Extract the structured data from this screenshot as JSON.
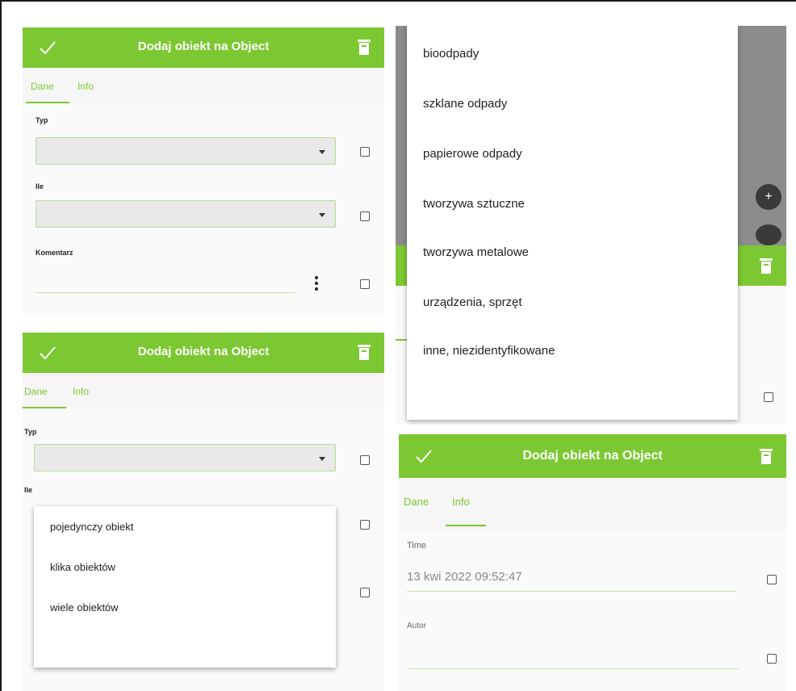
{
  "colors": {
    "accent": "#7cc832",
    "panel_bg": "#fafafa"
  },
  "panel_top_left": {
    "appbar": {
      "title": "Dodaj obiekt na Object",
      "confirm_icon": "check-icon",
      "delete_icon": "trash-icon"
    },
    "tabs": [
      "Dane",
      "Info"
    ],
    "active_tab": "Dane",
    "fields": {
      "typ_label": "Typ",
      "ile_label": "Ile",
      "komentarz_label": "Komentarz"
    }
  },
  "panel_bottom_left": {
    "appbar": {
      "title": "Dodaj obiekt na Object"
    },
    "tabs": [
      "Dane",
      "Info"
    ],
    "active_tab": "Dane",
    "fields": {
      "typ_label": "Typ",
      "ile_label": "Ile"
    },
    "dropdown_options": [
      "pojedynczy obiekt",
      "klika obiektów",
      "wiele obiektów"
    ]
  },
  "panel_top_right": {
    "dropdown_options": [
      "bioodpady",
      "szklane odpady",
      "papierowe odpady",
      "tworzywa sztuczne",
      "tworzywa metalowe",
      "urządzenia, sprzęt",
      "inne, niezidentyfikowane"
    ],
    "fab_label": "+"
  },
  "panel_bottom_right": {
    "appbar": {
      "title": "Dodaj obiekt na Object"
    },
    "tabs": [
      "Dane",
      "Info"
    ],
    "active_tab": "Info",
    "fields": {
      "time_label": "Time",
      "time_value": "13 kwi 2022 09:52:47",
      "autor_label": "Autor"
    }
  }
}
